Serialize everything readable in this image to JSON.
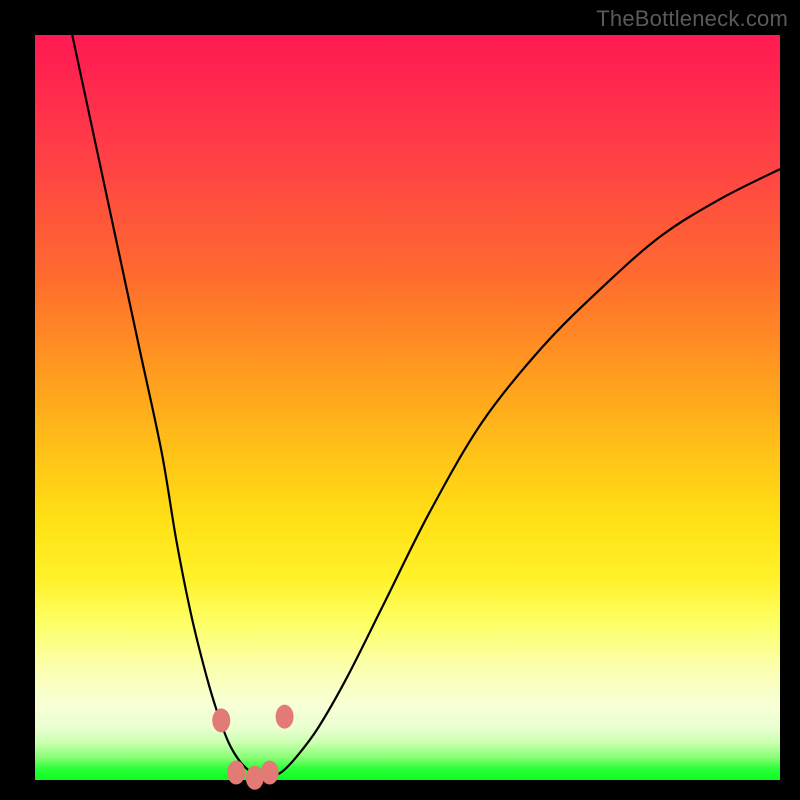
{
  "attribution": "TheBottleneck.com",
  "colors": {
    "top": "#ff1a52",
    "mid": "#ffe015",
    "bottom": "#0aff20",
    "marker": "#e47a76",
    "curve": "#000000",
    "frame": "#000000"
  },
  "chart_data": {
    "type": "line",
    "title": "",
    "xlabel": "",
    "ylabel": "",
    "xlim": [
      0,
      100
    ],
    "ylim": [
      0,
      100
    ],
    "grid": false,
    "legend": false,
    "series": [
      {
        "name": "bottleneck-curve",
        "x": [
          5,
          8,
          11,
          14,
          17,
          19,
          21,
          23,
          24.5,
          26,
          27.5,
          29,
          30,
          31,
          33,
          35,
          38,
          42,
          47,
          53,
          60,
          68,
          76,
          84,
          92,
          100
        ],
        "y": [
          100,
          86,
          72,
          58,
          44,
          32,
          22,
          14,
          9,
          5,
          2.5,
          1,
          0.3,
          0.3,
          1,
          3,
          7,
          14,
          24,
          36,
          48,
          58,
          66,
          73,
          78,
          82
        ]
      }
    ],
    "markers": [
      {
        "x": 25.0,
        "y": 8.0
      },
      {
        "x": 27.0,
        "y": 1.0
      },
      {
        "x": 29.5,
        "y": 0.3
      },
      {
        "x": 31.5,
        "y": 1.0
      },
      {
        "x": 33.5,
        "y": 8.5
      }
    ]
  }
}
